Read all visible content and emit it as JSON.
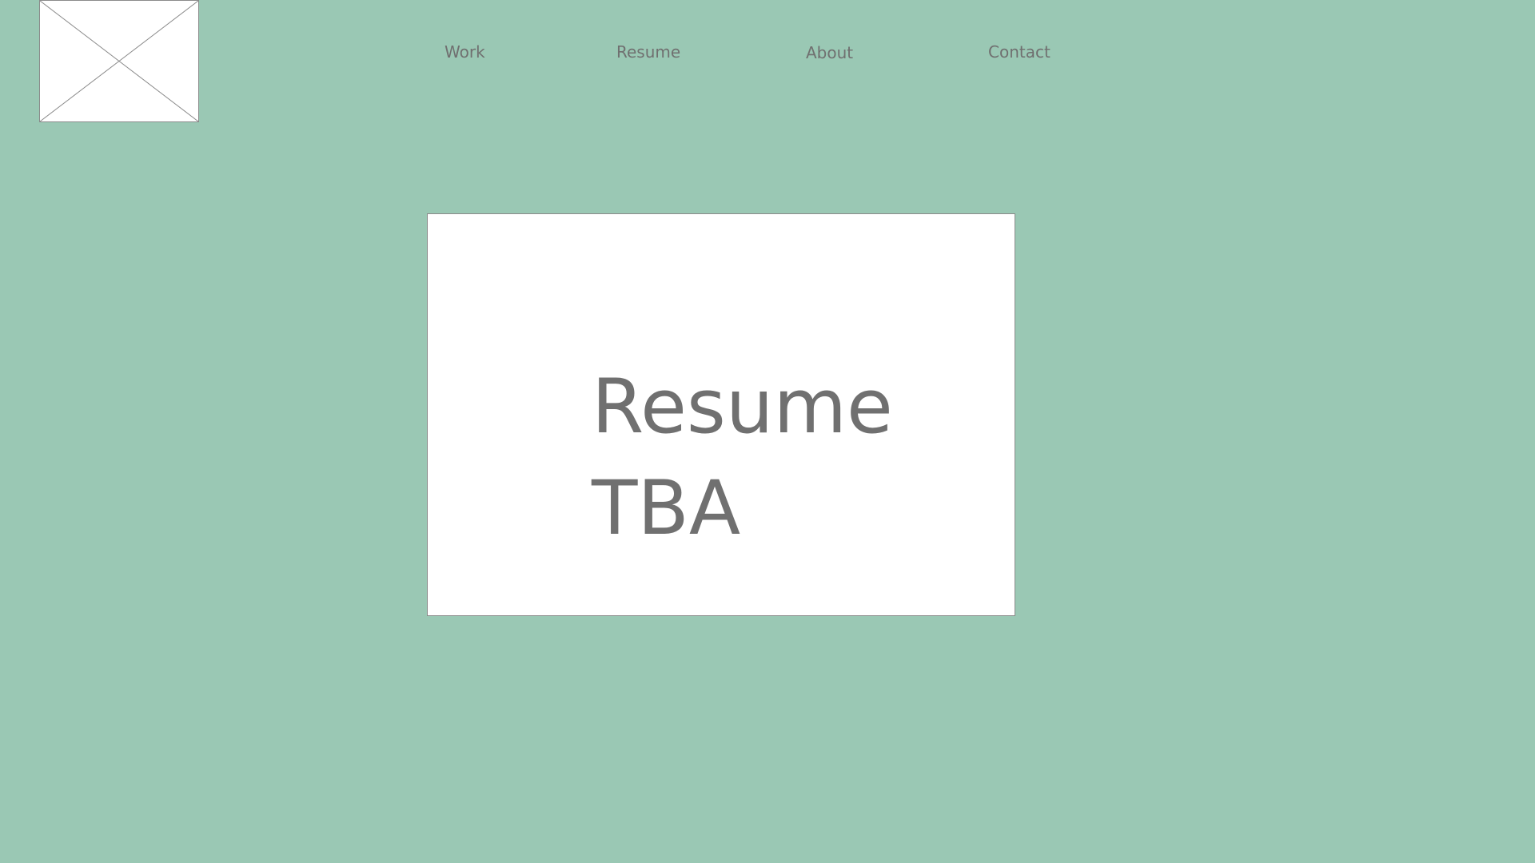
{
  "theme": {
    "background": "#9ac8b4",
    "text": "#707070",
    "card_background": "#ffffff",
    "border": "#8a8a8a"
  },
  "logo": {
    "icon": "image-placeholder-icon"
  },
  "nav": {
    "items": [
      {
        "label": "Work"
      },
      {
        "label": "Resume"
      },
      {
        "label": "About"
      },
      {
        "label": "Contact"
      }
    ]
  },
  "main": {
    "title_line1": "Resume",
    "title_line2": "TBA"
  }
}
